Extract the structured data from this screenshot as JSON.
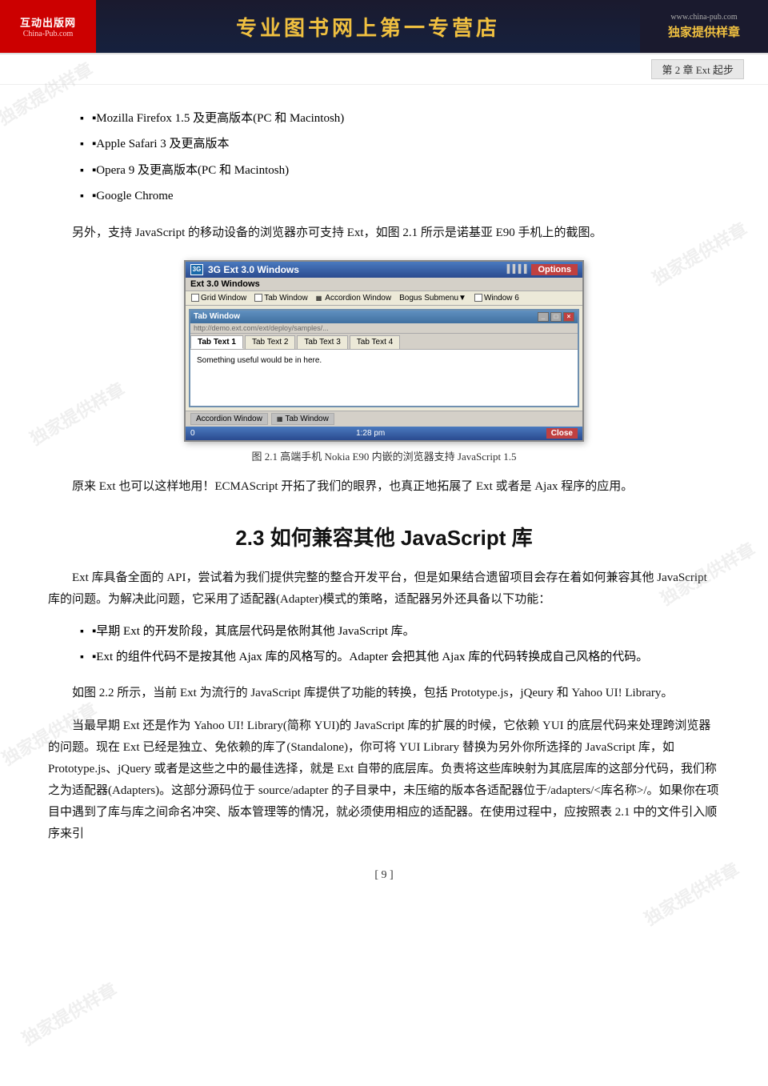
{
  "header": {
    "logo_top": "互动出版网",
    "logo_sub": "China-Pub.com",
    "title": "专业图书网上第一专营店",
    "url": "www.china-pub.com",
    "slogan": "独家提供样章"
  },
  "chapter_badge": "第 2 章   Ext 起步",
  "page_number": "[ 9 ]",
  "bullet_items": [
    "Mozilla Firefox 1.5 及更高版本(PC 和 Macintosh)",
    "Apple Safari 3 及更高版本",
    "Opera 9 及更高版本(PC 和 Macintosh)",
    "Google Chrome"
  ],
  "para1": "另外，支持 JavaScript 的移动设备的浏览器亦可支持 Ext，如图 2.1 所示是诺基亚 E90 手机上的截图。",
  "figure": {
    "title_bar_left": "3G  Ext 3.0 Windows",
    "title_bar_right": "Options",
    "subtitle": "Ext 3.0 Windows",
    "menu_items": [
      "Grid Window",
      "Tab Window",
      "Accordion Window",
      "Bogus Submenu▼",
      "Window 6"
    ],
    "inner_title": "Tab Window",
    "tabs": [
      "Tab Text 1",
      "Tab Text 2",
      "Tab Text 3",
      "Tab Text 4"
    ],
    "tab_content": "Something useful would be in here.",
    "bottom_left": "Accordion Window",
    "bottom_right": "Tab Window",
    "status_left": "0",
    "status_time": "1:28 pm",
    "status_close": "Close"
  },
  "figure_caption": "图 2.1    高端手机 Nokia E90 内嵌的浏览器支持 JavaScript 1.5",
  "para2": "原来 Ext 也可以这样地用！ECMAScript 开拓了我们的眼界，也真正地拓展了 Ext 或者是 Ajax 程序的应用。",
  "section_heading": "2.3   如何兼容其他 JavaScript 库",
  "para3": "Ext 库具备全面的 API，尝试着为我们提供完整的整合开发平台，但是如果结合遗留项目会存在着如何兼容其他 JavaScript 库的问题。为解决此问题，它采用了适配器(Adapter)模式的策略，适配器另外还具备以下功能：",
  "bullet2_items": [
    "早期 Ext 的开发阶段，其底层代码是依附其他 JavaScript 库。",
    "Ext 的组件代码不是按其他 Ajax 库的风格写的。Adapter 会把其他 Ajax 库的代码转换成自己风格的代码。"
  ],
  "para4": "如图 2.2 所示，当前 Ext 为流行的 JavaScript 库提供了功能的转换，包括 Prototype.js，jQeury 和 Yahoo UI! Library。",
  "para5": "当最早期 Ext 还是作为 Yahoo UI! Library(简称 YUI)的 JavaScript 库的扩展的时候，它依赖 YUI 的底层代码来处理跨浏览器的问题。现在 Ext 已经是独立、免依赖的库了(Standalone)，你可将 YUI Library 替换为另外你所选择的 JavaScript 库，如 Prototype.js、jQuery 或者是这些之中的最佳选择，就是 Ext 自带的底层库。负责将这些库映射为其底层库的这部分代码，我们称之为适配器(Adapters)。这部分源码位于 source/adapter 的子目录中，未压缩的版本各适配器位于/adapters/<库名称>/。如果你在项目中遇到了库与库之间命名冲突、版本管理等的情况，就必须使用相应的适配器。在使用过程中，应按照表 2.1 中的文件引入顺序来引"
}
